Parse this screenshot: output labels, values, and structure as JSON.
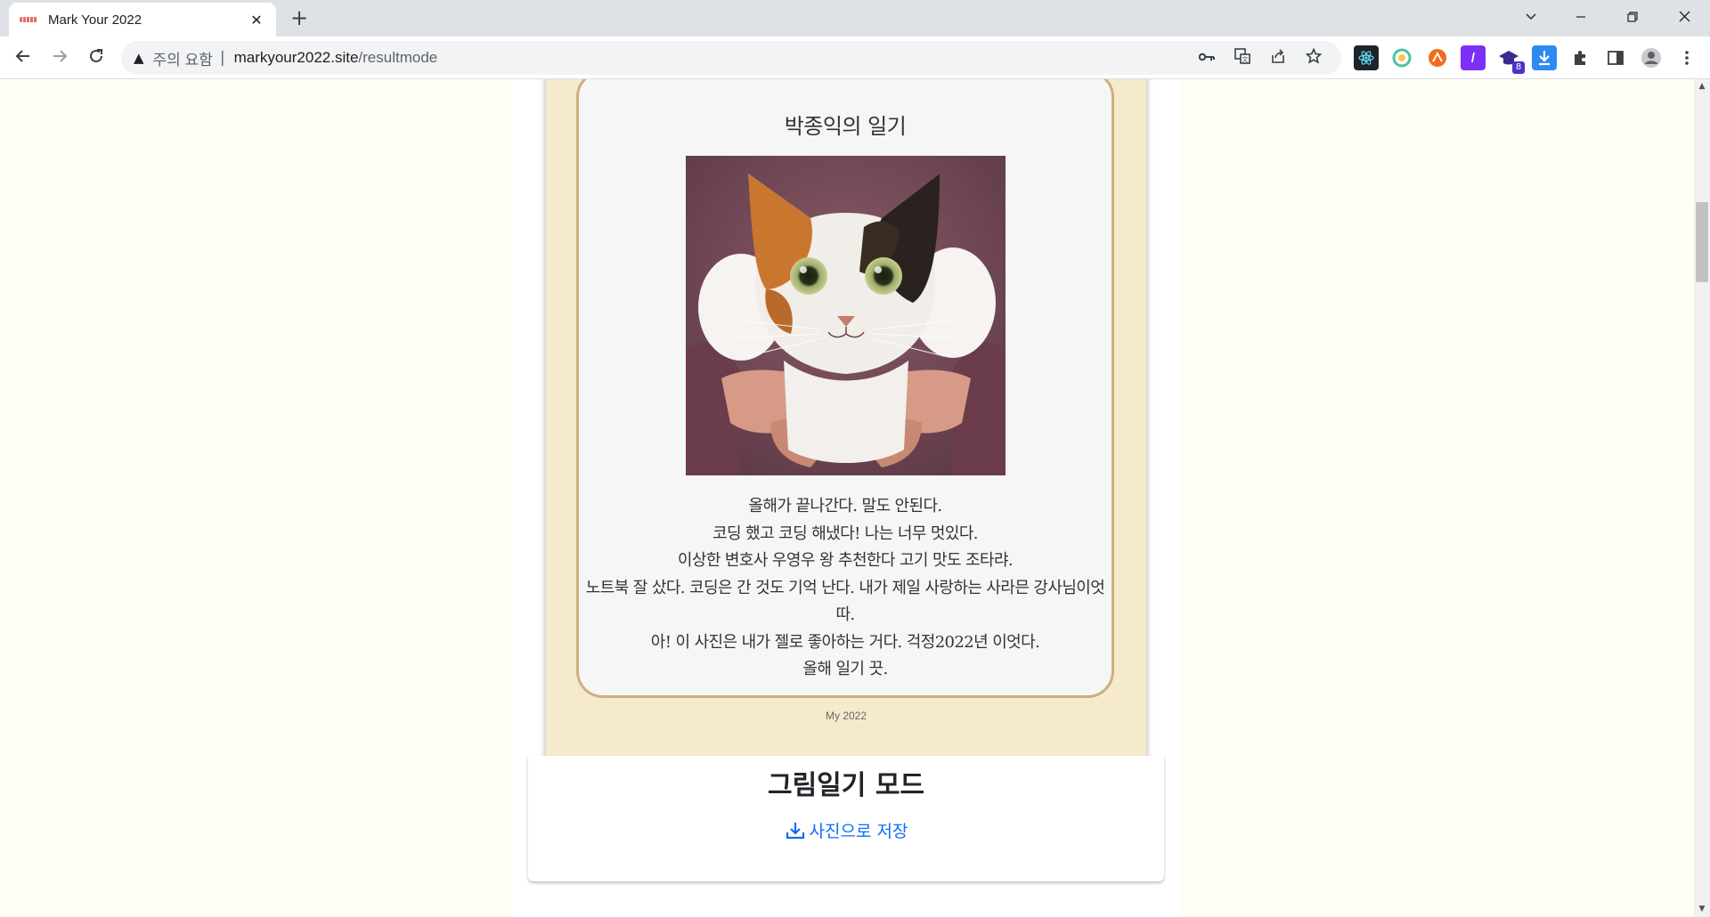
{
  "browser": {
    "tab_title": "Mark Your 2022",
    "tab_close": "✕",
    "new_tab": "+",
    "security_label": "주의 요함",
    "separator": "|",
    "url_host": "markyour2022.site",
    "url_path": "/resultmode",
    "icons": [
      "back-icon",
      "forward-icon",
      "reload-icon",
      "key-icon",
      "translate-icon",
      "share-icon",
      "star-icon",
      "extensions-icon",
      "side-panel-icon",
      "profile-icon",
      "menu-icon"
    ],
    "extension_badge": "8"
  },
  "diary": {
    "title": "박종익의 일기",
    "lines": [
      "올해가 끝나간다. 말도 안된다.",
      "코딩 했고 코딩 해냈다! 나는 너무 멋있다.",
      "이상한 변호사 우영우 왕 추천한다 고기 맛도 조타랴.",
      "노트북 잘 샀다. 코딩은 간 것도 기억 난다. 내가 제일 사랑하는 사라믄 강사님이엇따.",
      "아! 이 사진은 내가 젤로 좋아하는 거다. 걱정2022년 이엇다.",
      "올해 일기 끗."
    ],
    "footer": "My 2022",
    "photo_subject": "calico cat held up in hands"
  },
  "result": {
    "mode_title": "그림일기 모드",
    "save_label": "사진으로 저장"
  },
  "colors": {
    "page_bg": "#fffef4",
    "paper_bg": "#f5ebcc",
    "card_border": "#cbb17c",
    "link_blue": "#0d6efd"
  }
}
